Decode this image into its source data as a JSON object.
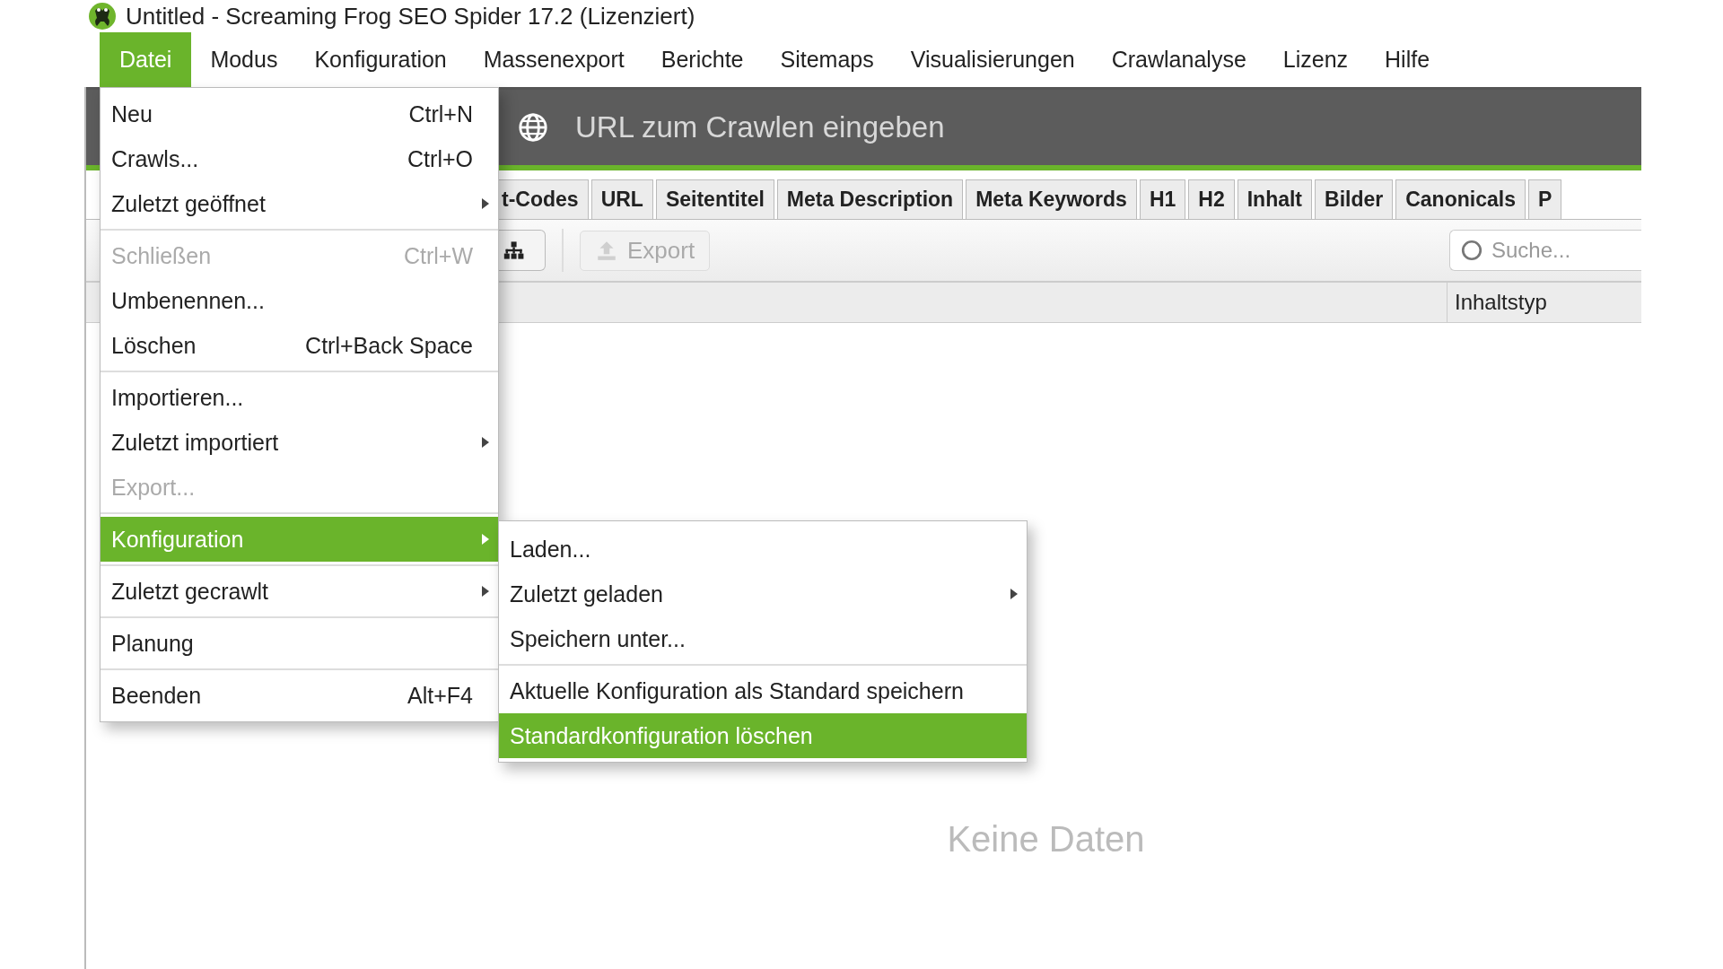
{
  "window": {
    "title": "Untitled - Screaming Frog SEO Spider 17.2 (Lizenziert)"
  },
  "menubar": [
    {
      "label": "Datei",
      "selected": true
    },
    {
      "label": "Modus",
      "selected": false
    },
    {
      "label": "Konfiguration",
      "selected": false
    },
    {
      "label": "Massenexport",
      "selected": false
    },
    {
      "label": "Berichte",
      "selected": false
    },
    {
      "label": "Sitemaps",
      "selected": false
    },
    {
      "label": "Visualisierungen",
      "selected": false
    },
    {
      "label": "Crawlanalyse",
      "selected": false
    },
    {
      "label": "Lizenz",
      "selected": false
    },
    {
      "label": "Hilfe",
      "selected": false
    }
  ],
  "url_bar": {
    "placeholder": "URL zum Crawlen eingeben"
  },
  "tabs": [
    "t-Codes",
    "URL",
    "Seitentitel",
    "Meta Description",
    "Meta Keywords",
    "H1",
    "H2",
    "Inhalt",
    "Bilder",
    "Canonicals",
    "P"
  ],
  "toolbar": {
    "export": {
      "label": "Export",
      "disabled": true
    }
  },
  "search": {
    "placeholder": "Suche..."
  },
  "table": {
    "columns": [
      "Inhaltstyp"
    ],
    "empty_message": "Keine Daten"
  },
  "file_menu": {
    "groups": [
      [
        {
          "label": "Neu",
          "shortcut": "Ctrl+N",
          "disabled": false,
          "submenu": false,
          "selected": false
        },
        {
          "label": "Crawls...",
          "shortcut": "Ctrl+O",
          "disabled": false,
          "submenu": false,
          "selected": false
        },
        {
          "label": "Zuletzt geöffnet",
          "disabled": false,
          "submenu": true,
          "selected": false
        }
      ],
      [
        {
          "label": "Schließen",
          "shortcut": "Ctrl+W",
          "disabled": true,
          "submenu": false,
          "selected": false
        },
        {
          "label": "Umbenennen...",
          "disabled": false,
          "submenu": false,
          "selected": false
        },
        {
          "label": "Löschen",
          "shortcut": "Ctrl+Back Space",
          "disabled": false,
          "submenu": false,
          "selected": false
        }
      ],
      [
        {
          "label": "Importieren...",
          "disabled": false,
          "submenu": false,
          "selected": false
        },
        {
          "label": "Zuletzt importiert",
          "disabled": false,
          "submenu": true,
          "selected": false
        },
        {
          "label": "Export...",
          "disabled": true,
          "submenu": false,
          "selected": false
        }
      ],
      [
        {
          "label": "Konfiguration",
          "disabled": false,
          "submenu": true,
          "selected": true
        }
      ],
      [
        {
          "label": "Zuletzt gecrawlt",
          "disabled": false,
          "submenu": true,
          "selected": false
        }
      ],
      [
        {
          "label": "Planung",
          "disabled": false,
          "submenu": false,
          "selected": false
        }
      ],
      [
        {
          "label": "Beenden",
          "shortcut": "Alt+F4",
          "disabled": false,
          "submenu": false,
          "selected": false
        }
      ]
    ]
  },
  "config_submenu": {
    "groups": [
      [
        {
          "label": "Laden...",
          "submenu": false,
          "selected": false
        },
        {
          "label": "Zuletzt geladen",
          "submenu": true,
          "selected": false
        },
        {
          "label": "Speichern unter...",
          "submenu": false,
          "selected": false
        }
      ],
      [
        {
          "label": "Aktuelle Konfiguration als Standard speichern",
          "submenu": false,
          "selected": false
        },
        {
          "label": "Standardkonfiguration löschen",
          "submenu": false,
          "selected": true
        }
      ]
    ]
  }
}
